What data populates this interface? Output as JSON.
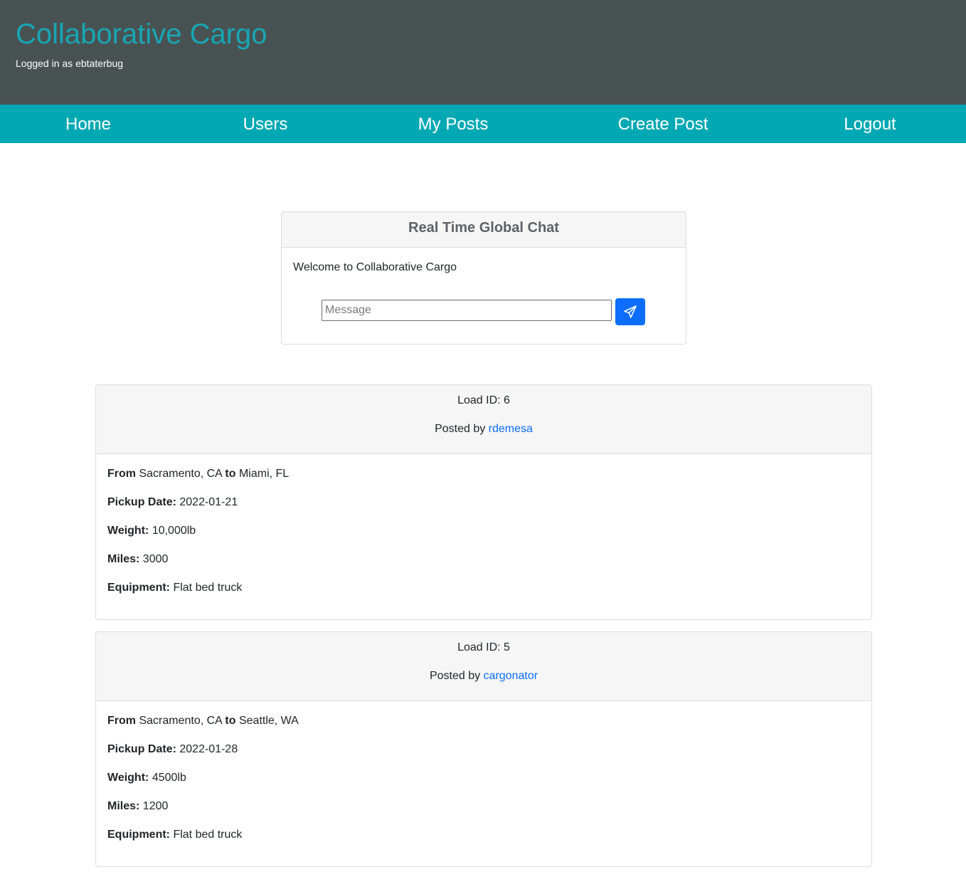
{
  "header": {
    "site_title": "Collaborative Cargo",
    "login_status": "Logged in as ebtaterbug"
  },
  "nav": {
    "items": [
      {
        "label": "Home"
      },
      {
        "label": "Users"
      },
      {
        "label": "My Posts"
      },
      {
        "label": "Create Post"
      },
      {
        "label": "Logout"
      }
    ]
  },
  "chat": {
    "title": "Real Time Global Chat",
    "messages": [
      "Welcome to Collaborative Cargo"
    ],
    "input_placeholder": "Message",
    "input_value": "",
    "send_icon": "paper-plane-icon"
  },
  "field_labels": {
    "from": "From",
    "to": "to",
    "pickup_date": "Pickup Date:",
    "weight": "Weight:",
    "miles": "Miles:",
    "equipment": "Equipment:",
    "load_id_prefix": "Load ID:",
    "posted_by_prefix": "Posted by"
  },
  "posts": [
    {
      "load_id": "6",
      "poster": "rdemesa",
      "from": "Sacramento, CA",
      "to": "Miami, FL",
      "pickup_date": "2022-01-21",
      "weight": "10,000lb",
      "miles": "3000",
      "equipment": "Flat bed truck"
    },
    {
      "load_id": "5",
      "poster": "cargonator",
      "from": "Sacramento, CA",
      "to": "Seattle, WA",
      "pickup_date": "2022-01-28",
      "weight": "4500lb",
      "miles": "1200",
      "equipment": "Flat bed truck"
    }
  ],
  "colors": {
    "header_bg": "#495252",
    "title": "#17a6b4",
    "nav_bg": "#00a8b4",
    "link": "#0d6efd",
    "send_button": "#0d6efd"
  }
}
